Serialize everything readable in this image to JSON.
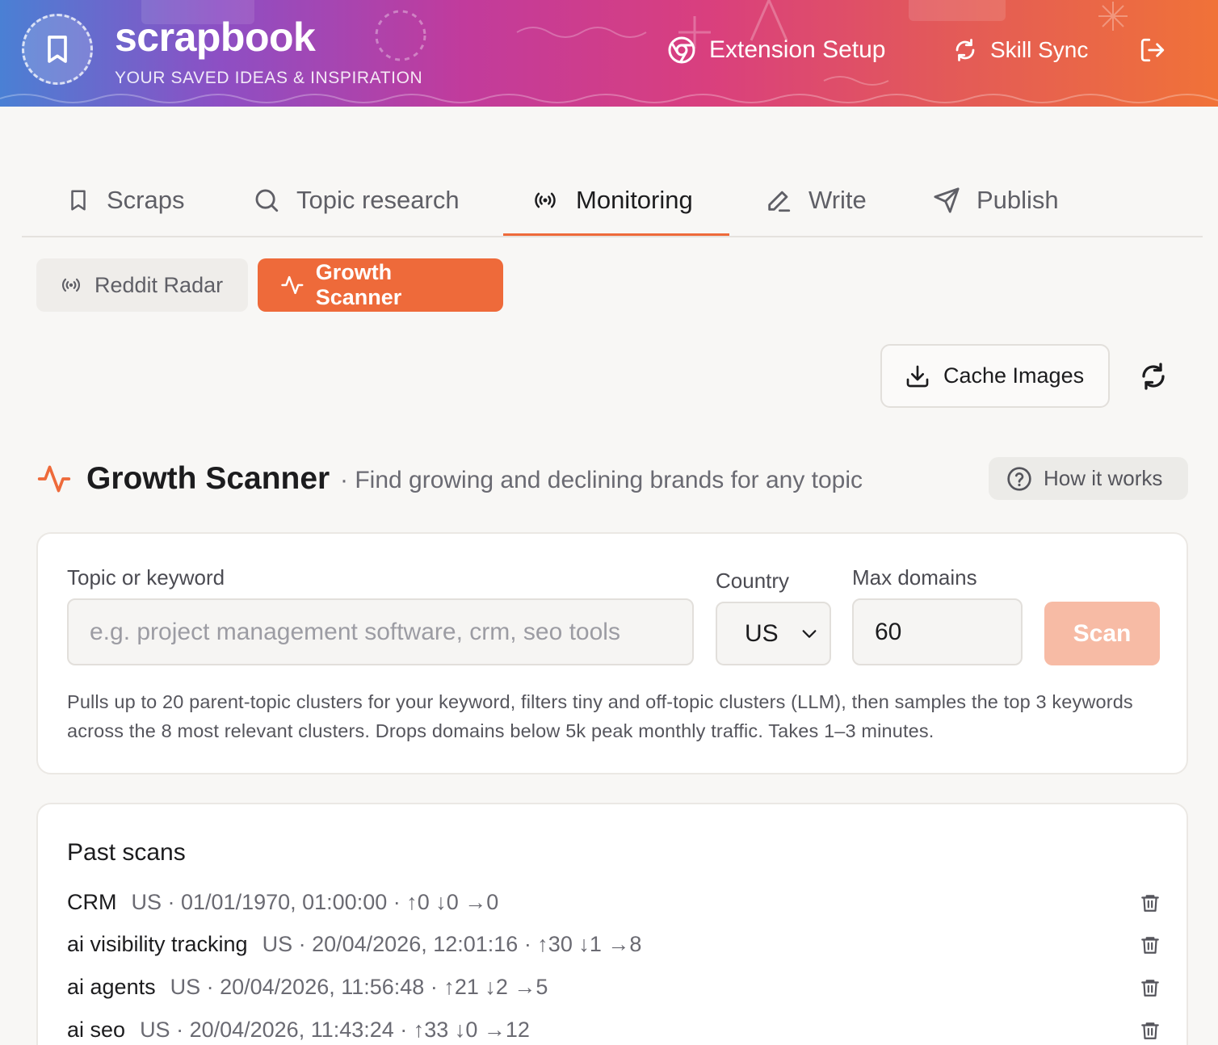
{
  "header": {
    "brand": "scrapbook",
    "tagline": "YOUR SAVED IDEAS & INSPIRATION",
    "extension_setup": "Extension Setup",
    "skill_sync": "Skill Sync"
  },
  "tabs": [
    {
      "label": "Scraps",
      "icon": "bookmark-icon"
    },
    {
      "label": "Topic research",
      "icon": "search-icon"
    },
    {
      "label": "Monitoring",
      "icon": "radio-icon",
      "active": true
    },
    {
      "label": "Write",
      "icon": "pencil-icon"
    },
    {
      "label": "Publish",
      "icon": "send-icon"
    }
  ],
  "subtabs": {
    "reddit": "Reddit Radar",
    "growth": "Growth Scanner"
  },
  "toolbar": {
    "cache_images": "Cache Images"
  },
  "scanner": {
    "title": "Growth Scanner",
    "subtitle": "· Find growing and declining brands for any topic",
    "how_it_works": "How it works"
  },
  "form": {
    "topic_label": "Topic or keyword",
    "topic_placeholder": "e.g. project management software, crm, seo tools",
    "topic_value": "",
    "country_label": "Country",
    "country_value": "US",
    "max_label": "Max domains",
    "max_value": "60",
    "scan_label": "Scan",
    "help": "Pulls up to 20 parent-topic clusters for your keyword, filters tiny and off-topic clusters (LLM), then samples the top 3 keywords across the 8 most relevant clusters. Drops domains below 5k peak monthly traffic. Takes 1–3 minutes."
  },
  "past_scans": {
    "title": "Past scans",
    "items": [
      {
        "name": "CRM",
        "meta": "US · 01/01/1970, 01:00:00 · ↑0 ↓0 →0"
      },
      {
        "name": "ai visibility tracking",
        "meta": "US · 20/04/2026, 12:01:16 · ↑30 ↓1 →8"
      },
      {
        "name": "ai agents",
        "meta": "US · 20/04/2026, 11:56:48 · ↑21 ↓2 →5"
      },
      {
        "name": "ai seo",
        "meta": "US · 20/04/2026, 11:43:24 · ↑33 ↓0 →12"
      }
    ]
  },
  "colors": {
    "accent": "#ee6a3a",
    "scan_disabled": "#f7bba5"
  }
}
